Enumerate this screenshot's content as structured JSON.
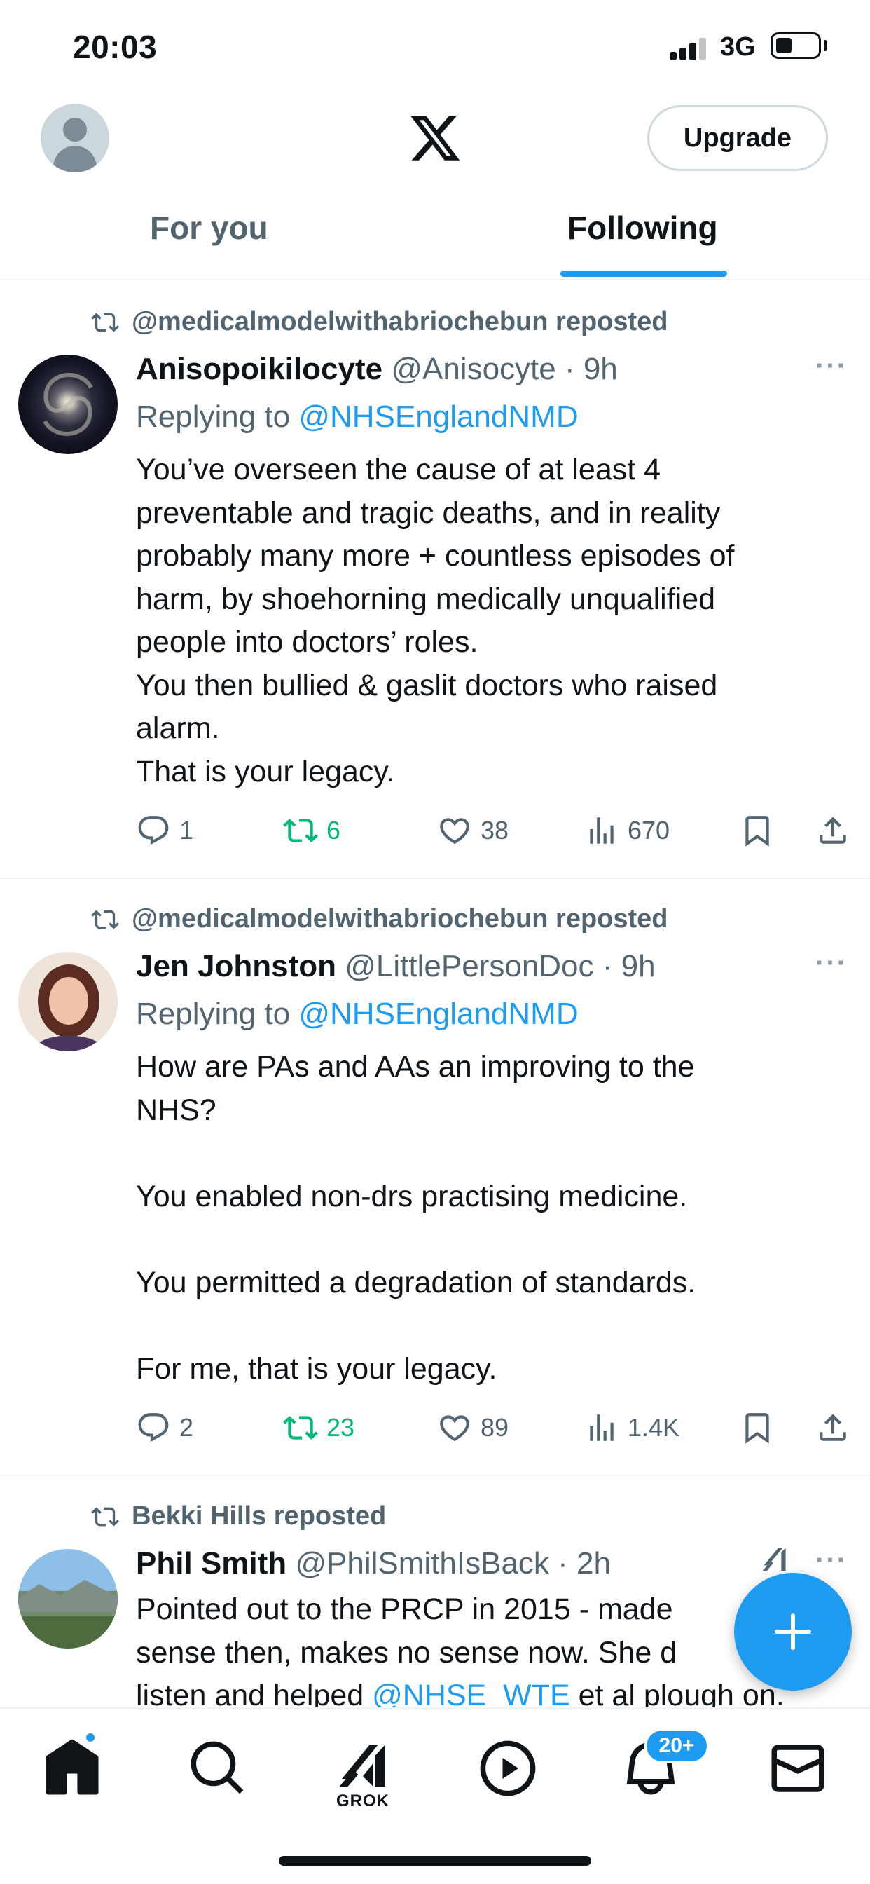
{
  "status_bar": {
    "time": "20:03",
    "network": "3G"
  },
  "header": {
    "upgrade_label": "Upgrade",
    "logo": "x-logo"
  },
  "tabs": [
    {
      "label": "For you",
      "active": false
    },
    {
      "label": "Following",
      "active": true
    }
  ],
  "posts": [
    {
      "repost_by": "@medicalmodelwithabriochebun reposted",
      "name": "Anisopoikilocyte",
      "handle": "@Anisocyte · 9h",
      "reply_prefix": "Replying to ",
      "reply_to": "@NHSEnglandNMD",
      "body": [
        "You’ve overseen the cause of at least 4",
        "preventable and tragic deaths, and in reality",
        "probably many more + countless episodes of",
        "harm, by shoehorning medically unqualified",
        "people into doctors’ roles.",
        "You then bullied & gaslit doctors who raised",
        "alarm.",
        "That is your legacy."
      ],
      "replies": "1",
      "reposts": "6",
      "likes": "38",
      "views": "670"
    },
    {
      "repost_by": "@medicalmodelwithabriochebun reposted",
      "name": "Jen Johnston",
      "handle": "@LittlePersonDoc · 9h",
      "reply_prefix": "Replying to ",
      "reply_to": "@NHSEnglandNMD",
      "body": [
        "How are PAs and AAs an improving to the",
        "NHS?",
        "",
        "You enabled non-drs practising medicine.",
        "",
        "You permitted a degradation of standards.",
        "",
        "For me, that is your legacy."
      ],
      "replies": "2",
      "reposts": "23",
      "likes": "89",
      "views": "1.4K"
    },
    {
      "repost_by": "Bekki Hills reposted",
      "name": "Phil Smith",
      "handle": "@PhilSmithIsBack · 2h",
      "body_line1": "Pointed out to the PRCP in 2015 - made",
      "body_line2": "sense then, makes no sense now.  She d",
      "body_line3_a": "listen and helped ",
      "body_line3_mention": "@NHSE_WTE",
      "body_line3_b": " et al plough on."
    }
  ],
  "bottom_nav": {
    "grok_label": "GROK",
    "notifications_badge": "20+"
  },
  "colors": {
    "accent": "#1d9bf0",
    "repost_green": "#00ba7c",
    "secondary_text": "#536471"
  }
}
